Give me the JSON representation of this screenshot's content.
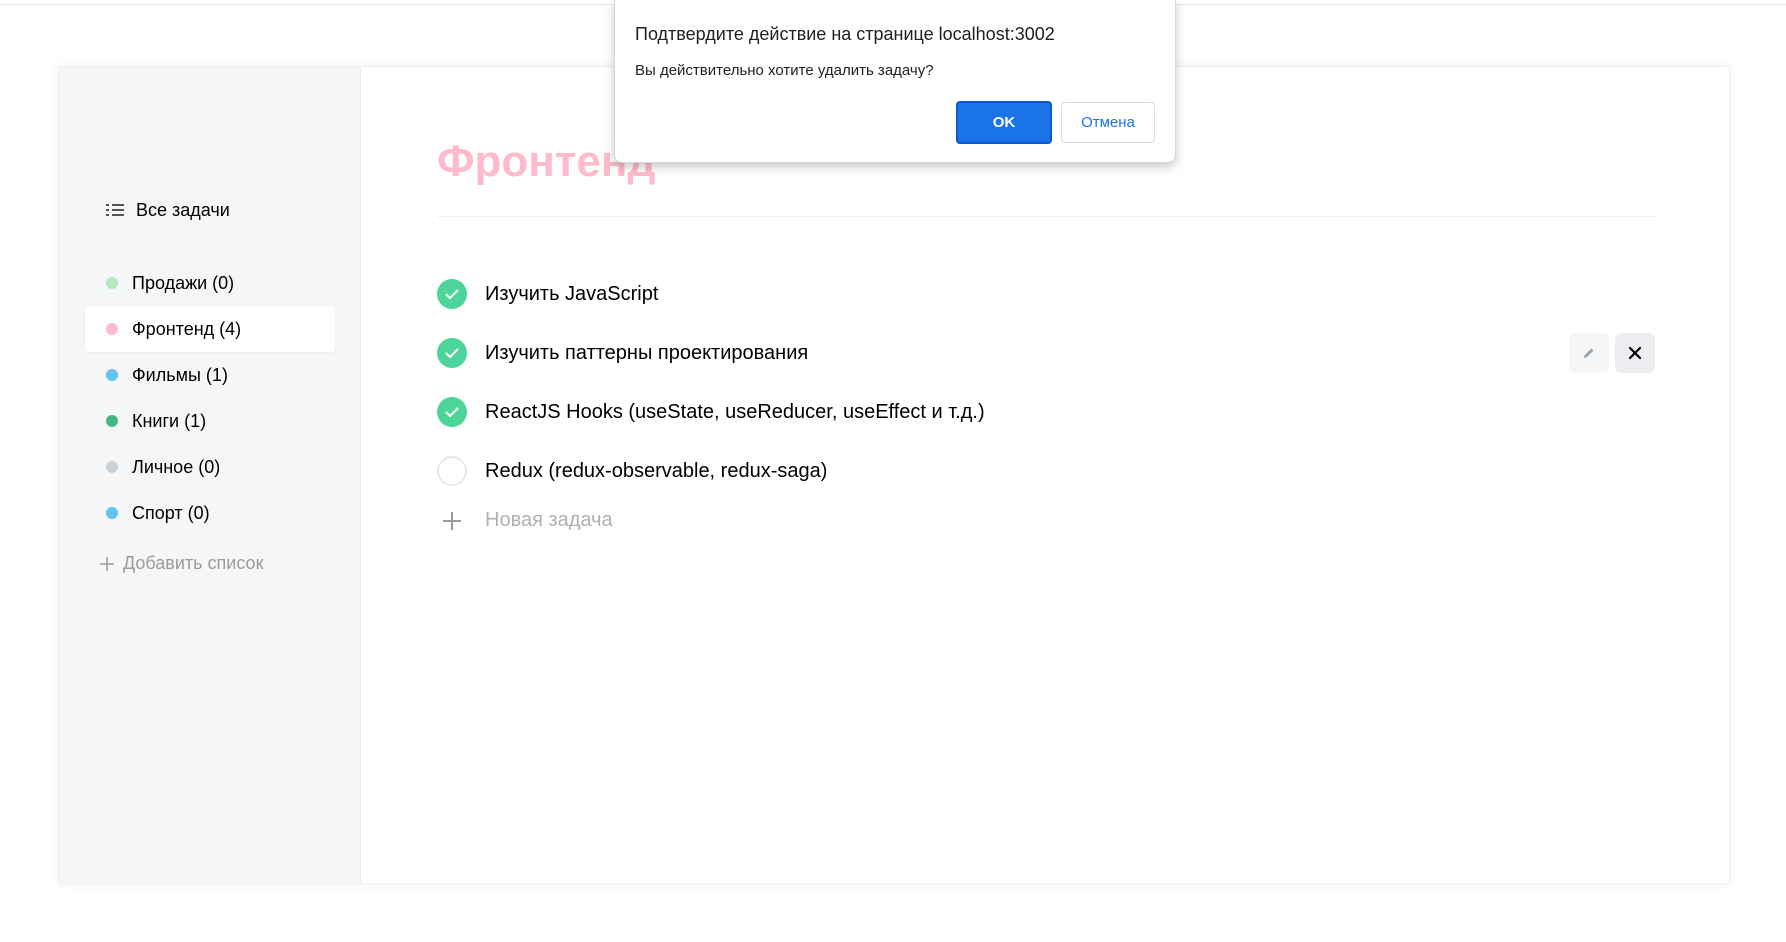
{
  "sidebar": {
    "all_tasks_label": "Все задачи",
    "lists": [
      {
        "label": "Продажи (0)",
        "color": "#b6e6bd"
      },
      {
        "label": "Фронтенд (4)",
        "color": "#ffbbcc"
      },
      {
        "label": "Фильмы (1)",
        "color": "#64c4ed"
      },
      {
        "label": "Книги (1)",
        "color": "#42b883"
      },
      {
        "label": "Личное (0)",
        "color": "#c9d1d3"
      },
      {
        "label": "Спорт (0)",
        "color": "#64c4ed"
      }
    ],
    "active_index": 1,
    "add_list_label": "Добавить список"
  },
  "main": {
    "title": "Фронтенд",
    "title_color": "#ffbbcc",
    "tasks": [
      {
        "text": "Изучить JavaScript",
        "completed": true
      },
      {
        "text": "Изучить паттерны проектирования",
        "completed": true,
        "hovered": true
      },
      {
        "text": "ReactJS Hooks (useState, useReducer, useEffect и т.д.)",
        "completed": true
      },
      {
        "text": "Redux (redux-observable, redux-saga)",
        "completed": false
      }
    ],
    "new_task_label": "Новая задача"
  },
  "dialog": {
    "title": "Подтвердите действие на странице localhost:3002",
    "message": "Вы действительно хотите удалить задачу?",
    "ok_label": "OK",
    "cancel_label": "Отмена"
  },
  "icons": {
    "all_tasks": "list-icon",
    "check": "check-icon",
    "edit": "pencil-icon",
    "remove": "close-icon",
    "add": "plus-icon"
  }
}
